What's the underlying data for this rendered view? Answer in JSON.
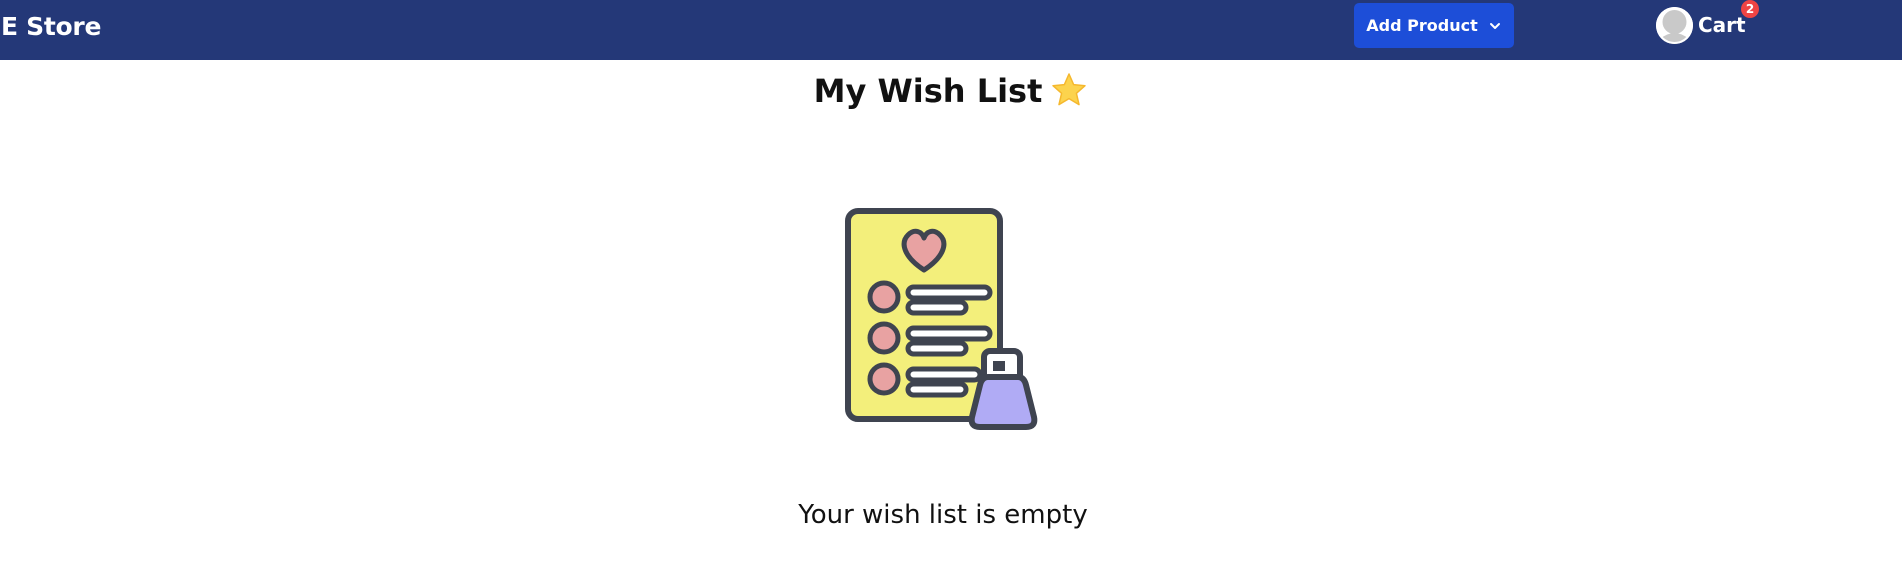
{
  "header": {
    "brand": "E Store",
    "add_product_label": "Add Product",
    "cart_label": "Cart",
    "cart_count": "2",
    "icons": {
      "chevron": "chevron-down-icon",
      "avatar": "user-avatar-icon"
    },
    "colors": {
      "navbar_bg": "#243878",
      "button_bg": "#1d4ed8",
      "badge_bg": "#ef4444"
    }
  },
  "main": {
    "title": "My Wish List",
    "title_icon": "star-icon",
    "illustration": "wishlist-document-with-bag-icon",
    "empty_message": "Your wish list is empty",
    "colors": {
      "star": "#fcd34d",
      "document": "#f3ef7b",
      "heart": "#e8a2a2",
      "bag": "#b0abf5",
      "outline": "#3f4450"
    }
  }
}
